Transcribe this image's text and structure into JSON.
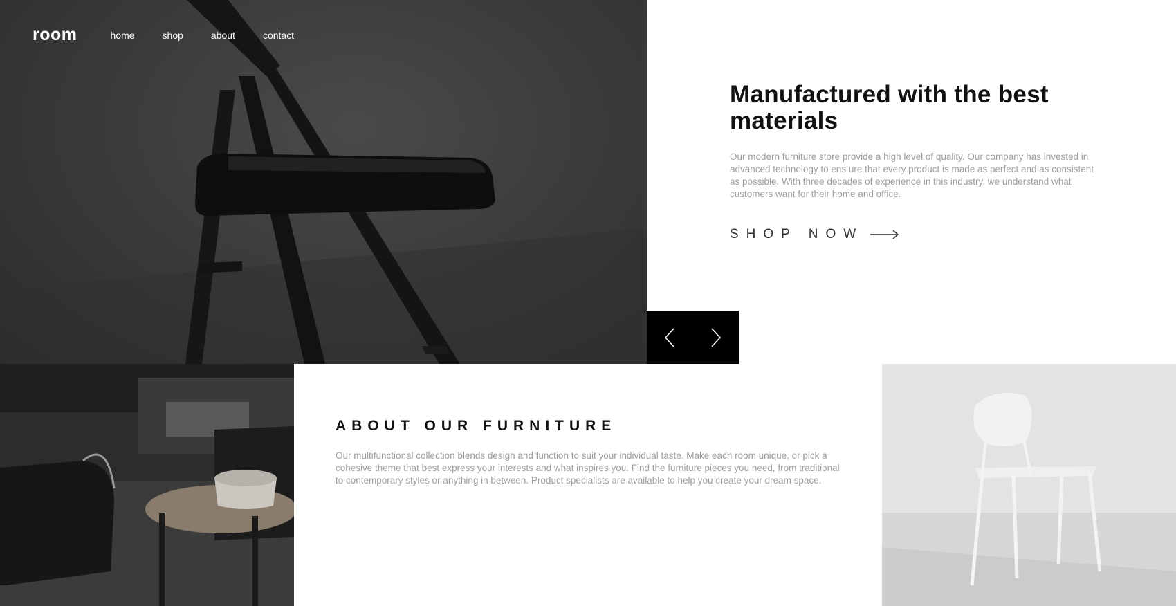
{
  "nav": {
    "logo": "room",
    "links": [
      "home",
      "shop",
      "about",
      "contact"
    ]
  },
  "hero": {
    "title": "Manufactured with the best materials",
    "description": "Our modern furniture store provide a high level of quality. Our company has invested in advanced technology to ens ure that every product is made as perfect and as consistent as possible. With three decades of experience in this industry, we understand what customers want for their home and office.",
    "cta_label": "SHOP NOW"
  },
  "slider": {
    "prev_icon": "chevron-left-icon",
    "next_icon": "chevron-right-icon"
  },
  "about": {
    "title": "ABOUT OUR FURNITURE",
    "description": "Our multifunctional collection blends design and function to suit your individual taste. Make each room unique, or pick a cohesive theme that best express your interests and what inspires you. Find the furniture pieces you need, from traditional to contemporary styles or anything in between. Product specialists are available to help you create your dream space."
  },
  "colors": {
    "text_dark": "#111111",
    "text_muted": "#9e9e9e",
    "slider_bg": "#000000",
    "hero_bg": "#3c3c3c"
  }
}
